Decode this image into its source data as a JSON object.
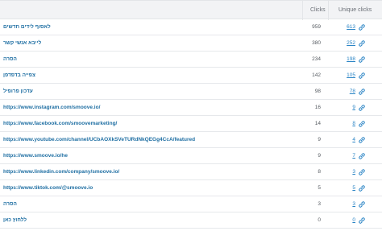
{
  "table": {
    "headers": {
      "clicks": "Clicks",
      "unique_clicks": "Unique clicks"
    },
    "rows": [
      {
        "name": "לאסוף לידים חדשים",
        "clicks": "959",
        "unique": "613"
      },
      {
        "name": "לייבא אנשי קשר",
        "clicks": "380",
        "unique": "252"
      },
      {
        "name": "הסרה",
        "clicks": "234",
        "unique": "198"
      },
      {
        "name": "צפייה בדפדפן",
        "clicks": "142",
        "unique": "105"
      },
      {
        "name": "עדכון פרופיל",
        "clicks": "98",
        "unique": "78"
      },
      {
        "name": "https://www.instagram.com/smoove.io/",
        "clicks": "16",
        "unique": "9"
      },
      {
        "name": "https://www.facebook.com/smoovemarketing/",
        "clicks": "14",
        "unique": "8"
      },
      {
        "name": "https://www.youtube.com/channel/UCbAOXkSVeTURdNkQEGg4CcA/featured",
        "clicks": "9",
        "unique": "4"
      },
      {
        "name": "https://www.smoove.io/he",
        "clicks": "9",
        "unique": "7"
      },
      {
        "name": "https://www.linkedin.com/company/smoove.io/",
        "clicks": "8",
        "unique": "3"
      },
      {
        "name": "https://www.tiktok.com/@smoove.io",
        "clicks": "5",
        "unique": "5"
      },
      {
        "name": "הסרה",
        "clicks": "3",
        "unique": "3"
      },
      {
        "name": "ללחוץ כאן",
        "clicks": "0",
        "unique": "0"
      }
    ]
  },
  "icons": {
    "row_link_icon": "chain-link-icon"
  },
  "colors": {
    "link": "#1f6fa3",
    "unique_link": "#2a84c5",
    "header_bg": "#f2f3f5"
  }
}
